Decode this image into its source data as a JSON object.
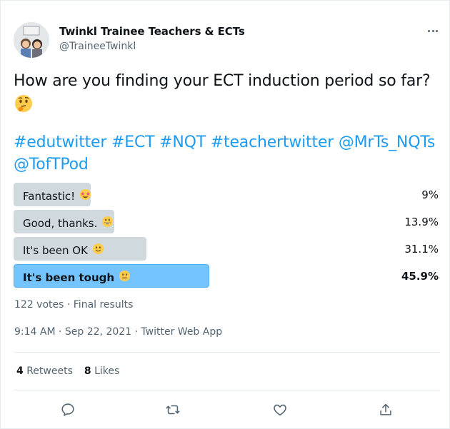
{
  "tweet": {
    "display_name": "Twinkl Trainee Teachers & ECTs",
    "handle": "@TraineeTwinkl",
    "text": "How are you finding your ECT induction period so far?",
    "text_emoji": "thinking-face-icon",
    "hashtags_line1": "#edutwitter #ECT #NQT #teachertwitter @MrTs_NQTs",
    "hashtags_line2": "@TofTPod"
  },
  "poll": {
    "options": [
      {
        "label": "Fantastic!",
        "emoji": "star-struck-icon",
        "percent_text": "9%",
        "percent": 9,
        "winner": false
      },
      {
        "label": "Good, thanks.",
        "emoji": "grinning-face-icon",
        "percent_text": "13.9%",
        "percent": 13.9,
        "winner": false
      },
      {
        "label": "It's been OK",
        "emoji": "slightly-smiling-face-icon",
        "percent_text": "31.1%",
        "percent": 31.1,
        "winner": false
      },
      {
        "label": "It's been tough",
        "emoji": "neutral-face-icon",
        "percent_text": "45.9%",
        "percent": 45.9,
        "winner": true
      }
    ],
    "summary": "122 votes · Final results"
  },
  "meta": {
    "timestamp": "9:14 AM · Sep 22, 2021 · Twitter Web App"
  },
  "stats": {
    "retweets_count": "4",
    "retweets_label": "Retweets",
    "likes_count": "8",
    "likes_label": "Likes"
  },
  "colors": {
    "link": "#1d9bf0",
    "poll_bar": "#cfd9de",
    "poll_winner": "#74c5ff",
    "muted": "#536471"
  },
  "actions": [
    "reply-icon",
    "retweet-icon",
    "like-icon",
    "share-icon"
  ]
}
